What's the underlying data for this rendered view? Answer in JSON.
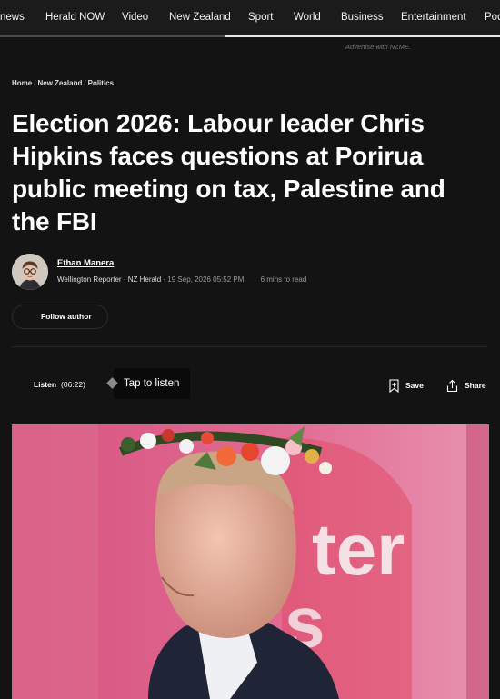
{
  "nav": {
    "items": [
      "news",
      "Herald NOW",
      "Video",
      "New Zealand",
      "Sport",
      "World",
      "Business",
      "Entertainment",
      "Podcasts"
    ],
    "scroll_progress": 0.45
  },
  "ad": {
    "label": "Advertise with NZME."
  },
  "breadcrumb": {
    "home": "Home",
    "section": "New Zealand",
    "subsection": "Politics",
    "separator": "/"
  },
  "article": {
    "headline": "Election 2026: Labour leader Chris Hipkins faces questions at Porirua public meeting on tax, Palestine and the FBI"
  },
  "author": {
    "name": "Ethan Manera",
    "role": "Wellington Reporter",
    "outlet": "NZ Herald",
    "date": "19 Sep, 2026 05:52 PM",
    "read_time": "6 mins to read",
    "follow_label": "Follow author",
    "sep": "·"
  },
  "actions": {
    "listen_label": "Listen",
    "listen_duration": "(06:22)",
    "tooltip": "Tap to listen",
    "save_label": "Save",
    "share_label": "Share"
  },
  "colors": {
    "background": "#131313",
    "hero_pink": "#d95a8a"
  },
  "icons": [
    "headphones-icon",
    "plus-icon",
    "bookmark-icon",
    "share-icon"
  ]
}
